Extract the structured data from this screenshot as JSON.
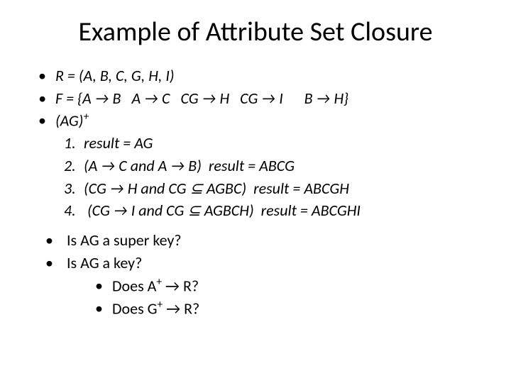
{
  "title": "Example of Attribute Set Closure",
  "b1": {
    "lead": "R = (A, B, C, G, H, I)"
  },
  "b2": {
    "lead": "F = {",
    "f1a": "A ",
    "arr": "→",
    "f1b": " B",
    "f2a": "A ",
    "f2b": " C",
    "f3a": "CG ",
    "f3b": " H",
    "f4a": "CG ",
    "f4b": " I",
    "f5a": "B ",
    "f5b": " H}",
    "sp": "   "
  },
  "b3": {
    "lead_a": "(AG)",
    "lead_sup": "+"
  },
  "s1": {
    "a": "result = AG"
  },
  "s2": {
    "a": "(A ",
    "b": " C",
    "and": " and ",
    "c": "A ",
    "d": " B)  ",
    "r": "result = ABCG"
  },
  "s3": {
    "a": "(CG ",
    "b": " H",
    "and": " and ",
    "c": "CG ",
    "sub": "⊆",
    "d": " AGBC)  ",
    "r": "result = ABCGH"
  },
  "s4": {
    "pre": " ",
    "a": "(CG ",
    "b": " I",
    "and": " and ",
    "c": "CG ",
    "sub": "⊆",
    "d": " AGBCH)  ",
    "r": "result = ABCGHI"
  },
  "q1": "Is AG a super key?",
  "q2": "Is AG a key?",
  "q2a": {
    "a": "Does A",
    "sup": "+",
    "b": " ",
    "c": " R?"
  },
  "q2b": {
    "a": "Does G",
    "sup": "+",
    "b": " ",
    "c": " R?"
  }
}
